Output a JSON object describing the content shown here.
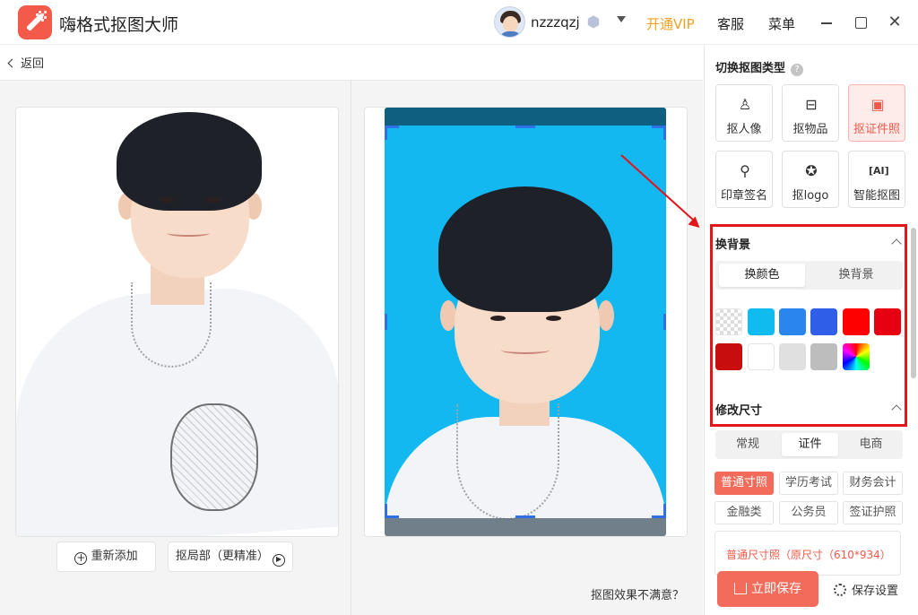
{
  "app": {
    "title": "嗨格式抠图大师"
  },
  "user": {
    "name": "nzzzqzj"
  },
  "topbar": {
    "vip": "开通VIP",
    "service": "客服",
    "menu": "菜单"
  },
  "nav": {
    "back": "返回"
  },
  "actions": {
    "re_add": "重新添加",
    "local_cutout": "抠局部（更精准）",
    "unhappy": "抠图效果不满意？"
  },
  "panel": {
    "switch_title": "切换抠图类型",
    "types": [
      {
        "label": "抠人像",
        "icon": "person-icon"
      },
      {
        "label": "抠物品",
        "icon": "inbox-icon"
      },
      {
        "label": "抠证件照",
        "icon": "id-card-icon",
        "active": true
      },
      {
        "label": "印章签名",
        "icon": "stamp-icon"
      },
      {
        "label": "抠logo",
        "icon": "badge-icon"
      },
      {
        "label": "智能抠图",
        "icon": "ai-icon"
      }
    ],
    "bg_title": "换背景",
    "bg_tabs": [
      "换颜色",
      "换背景"
    ],
    "colors": [
      "transparent",
      "#10bbf0",
      "#2a86ee",
      "#2f5fe8",
      "#ff0000",
      "#e60012",
      "#c80d0d",
      "#ffffff",
      "#e0e0e0",
      "#bdbdbd",
      "rainbow"
    ],
    "resize_title": "修改尺寸",
    "size_tabs": [
      "常规",
      "证件",
      "电商"
    ],
    "size_tags": [
      "普通寸照",
      "学历考试",
      "财务会计",
      "金融类",
      "公务员",
      "签证护照"
    ],
    "size_detail": "普通尺寸照（原尺寸（610*934）",
    "save": "立即保存",
    "save_settings": "保存设置"
  },
  "colors": {
    "accent": "#f26b5b",
    "id_background": "#12b8ef",
    "highlight": "#e3141a",
    "vip": "#f0a020"
  }
}
